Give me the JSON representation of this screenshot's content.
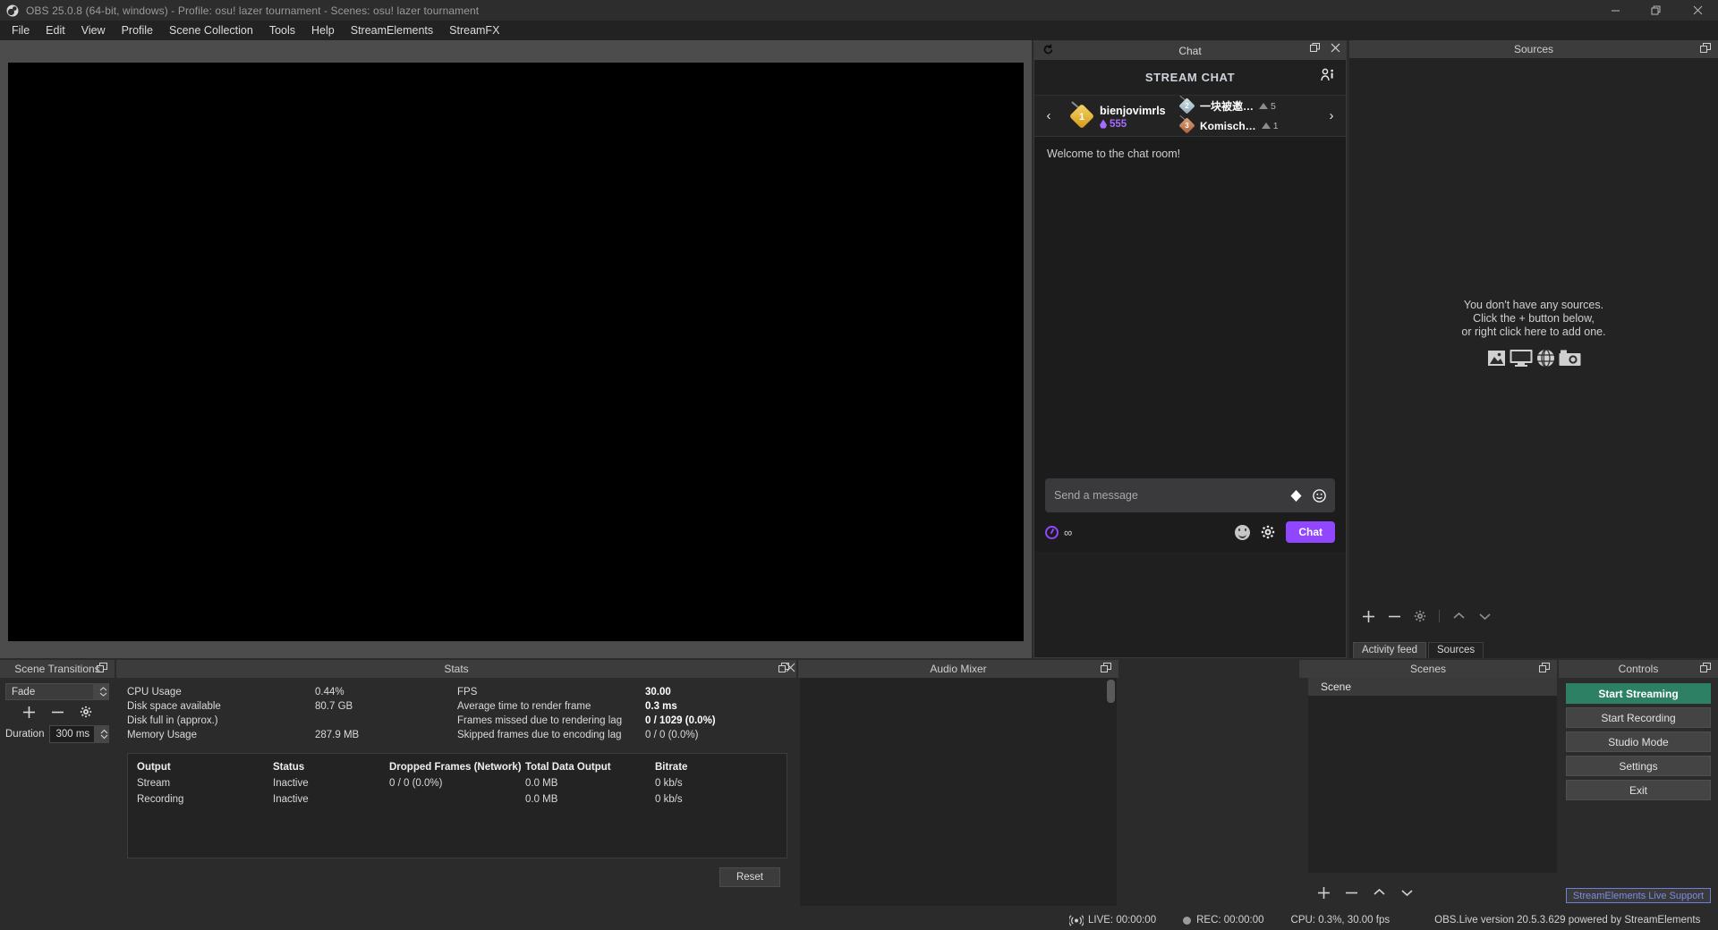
{
  "window": {
    "title": "OBS 25.0.8 (64-bit, windows) - Profile: osu! lazer tournament - Scenes: osu! lazer tournament",
    "minimize_label": "minimize",
    "maximize_label": "maximize",
    "close_label": "close"
  },
  "menubar": {
    "items": [
      {
        "label": "File"
      },
      {
        "label": "Edit"
      },
      {
        "label": "View"
      },
      {
        "label": "Profile"
      },
      {
        "label": "Scene Collection"
      },
      {
        "label": "Tools"
      },
      {
        "label": "Help"
      },
      {
        "label": "StreamElements"
      },
      {
        "label": "StreamFX"
      }
    ]
  },
  "chat_dock": {
    "title": "Chat",
    "reload_icon": "reload-icon",
    "header": "STREAM CHAT",
    "leaderboard": {
      "prev_arrow": "‹",
      "next_arrow": "›",
      "top": {
        "rank": "1",
        "name": "bienjovimrls",
        "points": "555",
        "medal_color": "#e3a81f"
      },
      "others": [
        {
          "rank": "2",
          "name": "一块被邀…",
          "score": "5",
          "medal_color": "#a9c8cf"
        },
        {
          "rank": "3",
          "name": "Komisch…",
          "score": "1",
          "medal_color": "#c07a52"
        }
      ]
    },
    "message": "Welcome to the chat room!",
    "input_placeholder": "Send a message",
    "bits_value": "∞",
    "send_button": "Chat"
  },
  "sources_dock": {
    "title": "Sources",
    "empty_line1": "You don't have any sources.",
    "empty_line2": "Click the + button below,",
    "empty_line3": "or right click here to add one.",
    "empty_icons": [
      "image-icon",
      "display-icon",
      "browser-icon",
      "camera-icon"
    ],
    "toolbar": [
      "add-icon",
      "remove-icon",
      "properties-gear-icon",
      "move-up-icon",
      "move-down-icon"
    ],
    "tabs": [
      {
        "label": "Activity feed",
        "active": false
      },
      {
        "label": "Sources",
        "active": true
      }
    ]
  },
  "scene_transitions": {
    "title": "Scene Transitions",
    "transition": "Fade",
    "duration_label": "Duration",
    "duration_value": "300 ms"
  },
  "stats": {
    "title": "Stats",
    "left": [
      {
        "key": "CPU Usage",
        "value": "0.44%",
        "bold": false
      },
      {
        "key": "Disk space available",
        "value": "80.7 GB",
        "bold": false
      },
      {
        "key": "Disk full in (approx.)",
        "value": "",
        "bold": false
      },
      {
        "key": "Memory Usage",
        "value": "287.9 MB",
        "bold": false
      }
    ],
    "right": [
      {
        "key": "FPS",
        "value": "30.00",
        "bold": true
      },
      {
        "key": "Average time to render frame",
        "value": "0.3 ms",
        "bold": true
      },
      {
        "key": "Frames missed due to rendering lag",
        "value": "0 / 1029 (0.0%)",
        "bold": true
      },
      {
        "key": "Skipped frames due to encoding lag",
        "value": "0 / 0 (0.0%)",
        "bold": false
      }
    ],
    "table": {
      "headers": [
        "Output",
        "Status",
        "Dropped Frames (Network)",
        "Total Data Output",
        "Bitrate"
      ],
      "rows": [
        [
          "Stream",
          "Inactive",
          "0 / 0 (0.0%)",
          "0.0 MB",
          "0 kb/s"
        ],
        [
          "Recording",
          "Inactive",
          "",
          "0.0 MB",
          "0 kb/s"
        ]
      ]
    },
    "reset_button": "Reset"
  },
  "audio_mixer": {
    "title": "Audio Mixer"
  },
  "scenes": {
    "title": "Scenes",
    "items": [
      {
        "label": "Scene",
        "selected": true
      }
    ],
    "toolbar": [
      "add-icon",
      "remove-icon",
      "move-up-icon",
      "move-down-icon"
    ]
  },
  "controls": {
    "title": "Controls",
    "buttons": [
      {
        "label": "Start Streaming",
        "primary": true
      },
      {
        "label": "Start Recording",
        "primary": false
      },
      {
        "label": "Studio Mode",
        "primary": false
      },
      {
        "label": "Settings",
        "primary": false
      },
      {
        "label": "Exit",
        "primary": false
      }
    ],
    "support_button": "StreamElements Live Support"
  },
  "statusbar": {
    "live": "LIVE: 00:00:00",
    "rec": "REC: 00:00:00",
    "cpu": "CPU: 0.3%, 30.00 fps",
    "version": "OBS.Live version 20.5.3.629 powered by StreamElements"
  },
  "colors": {
    "accent_green": "#2d8063",
    "twitch_purple": "#9147ff",
    "link_blue": "#7b8ce6"
  }
}
